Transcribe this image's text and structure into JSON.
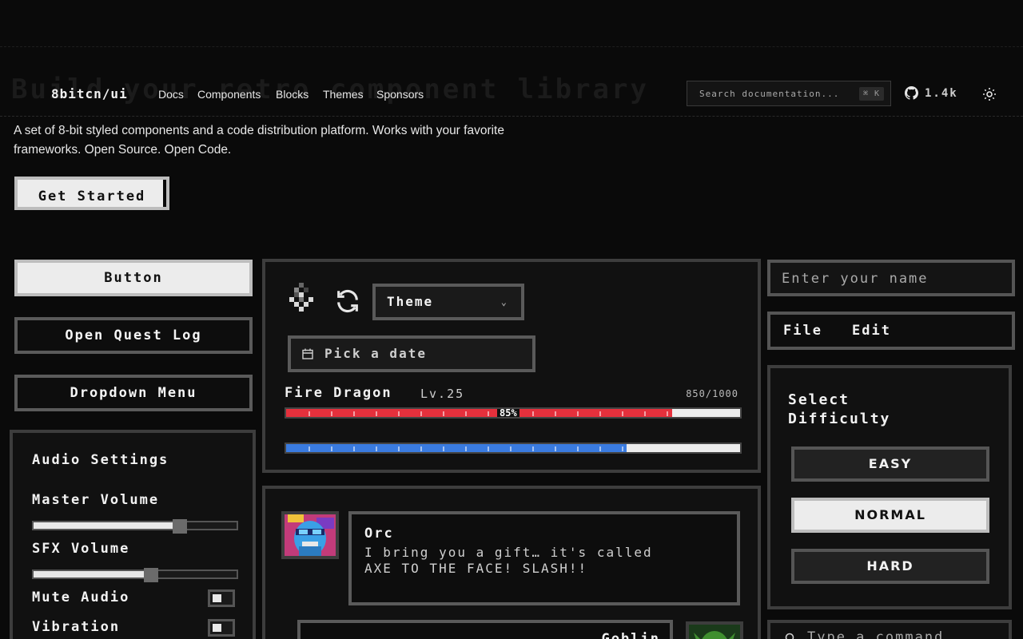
{
  "hero": {
    "background_title": "Build your retro component library",
    "description": "A set of 8-bit styled components and a code distribution platform. Works with your favorite frameworks. Open Source. Open Code.",
    "cta_label": "Get Started"
  },
  "nav": {
    "logo": "8bitcn/ui",
    "links": [
      "Docs",
      "Components",
      "Blocks",
      "Themes",
      "Sponsors"
    ],
    "search_placeholder": "Search documentation...",
    "search_shortcut": "⌘ K",
    "github_stars": "1.4k"
  },
  "left_column": {
    "button_label": "Button",
    "quest_log_label": "Open Quest Log",
    "dropdown_label": "Dropdown Menu",
    "audio": {
      "title": "Audio Settings",
      "master_label": "Master Volume",
      "master_value": 0.72,
      "sfx_label": "SFX Volume",
      "sfx_value": 0.58,
      "mute_label": "Mute Audio",
      "vibration_label": "Vibration"
    }
  },
  "middle_column": {
    "theme_select": "Theme",
    "date_placeholder": "Pick a date",
    "boss": {
      "name": "Fire Dragon",
      "level": "Lv.25",
      "hp_text": "850/1000",
      "hp_percent_label": "85%",
      "hp_fraction": 0.85,
      "mana_fraction": 0.75
    },
    "dialog": {
      "speaker": "Orc",
      "text": "I bring you a gift… it's called AXE TO THE FACE! SLASH!!",
      "next_speaker": "Goblin"
    }
  },
  "right_column": {
    "name_placeholder": "Enter your name",
    "menubar": [
      "File",
      "Edit"
    ],
    "difficulty_title": "Select Difficulty",
    "difficulty_options": [
      "EASY",
      "NORMAL",
      "HARD"
    ],
    "selected_difficulty": "NORMAL",
    "command_placeholder": "Type a command"
  },
  "colors": {
    "background": "#0a0a0a",
    "hp_red": "#e5303c",
    "mana_blue": "#3a7be0",
    "orc_skin": "#3aa0e6",
    "goblin_green": "#3f8f2f"
  },
  "icons": [
    "github-icon",
    "sun-icon",
    "calendar-icon",
    "refresh-icon",
    "chevron-down-icon",
    "search-icon"
  ]
}
